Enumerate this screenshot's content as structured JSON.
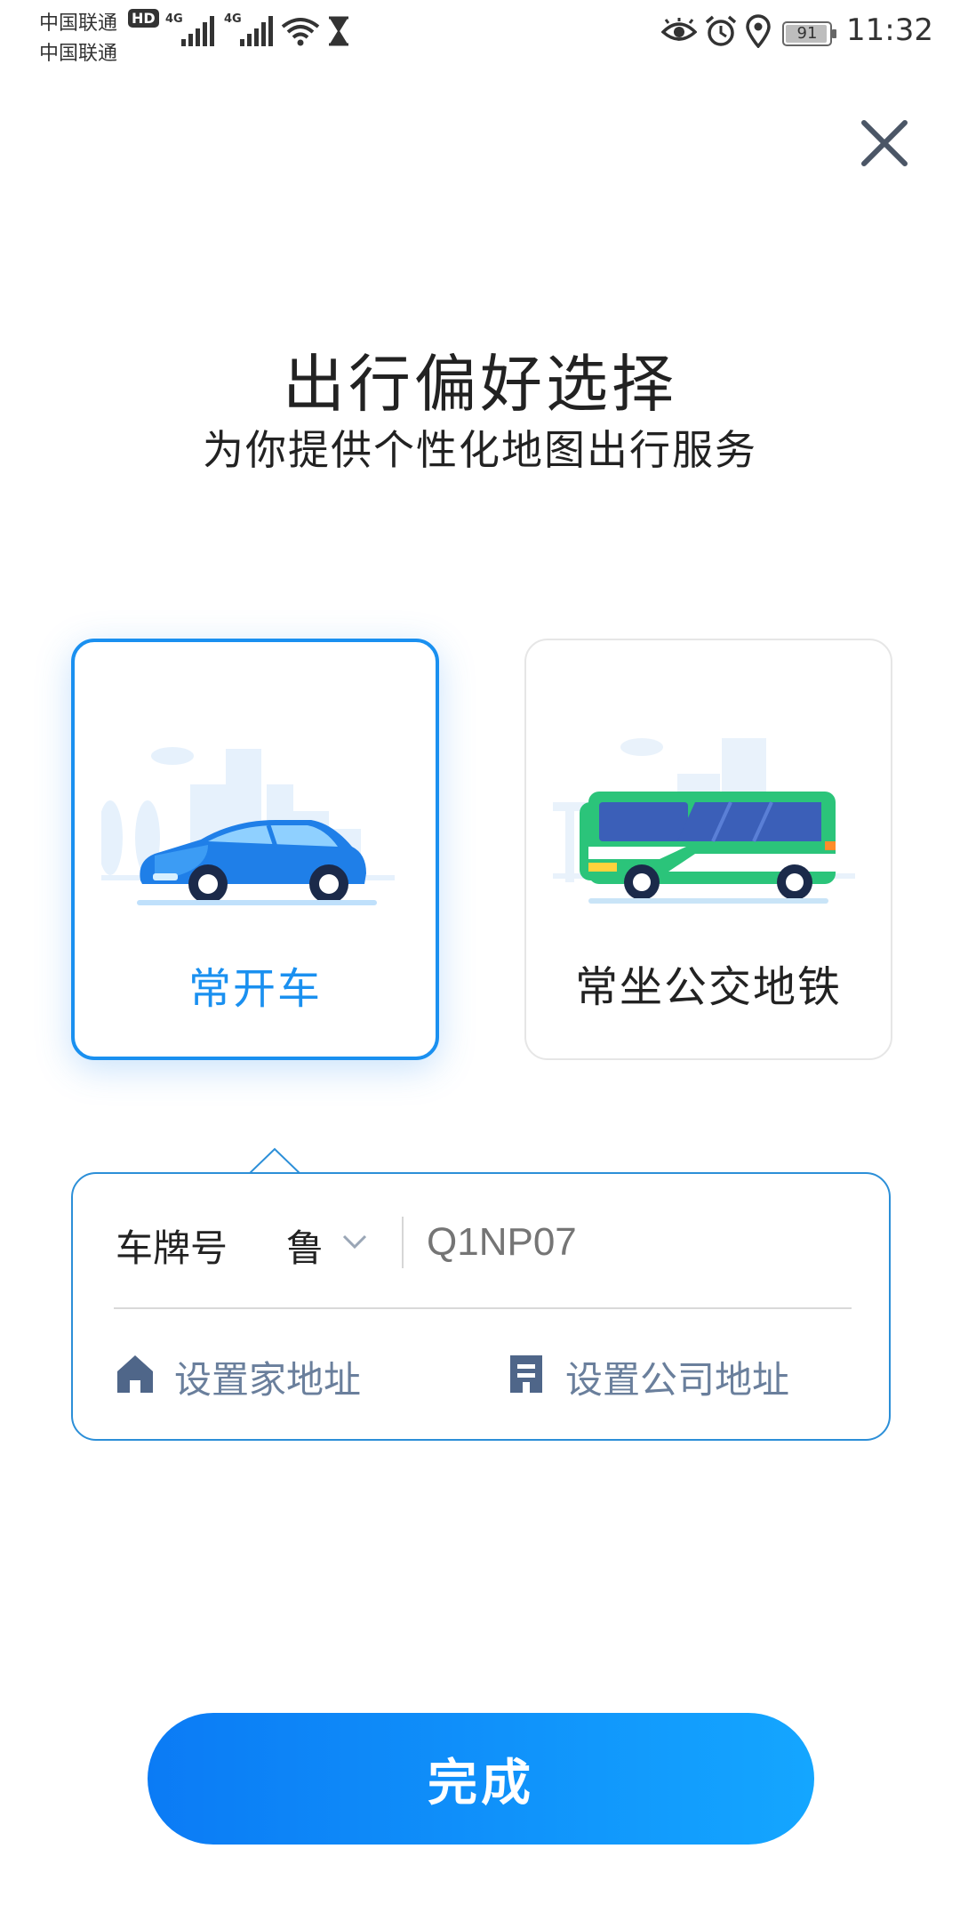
{
  "status_bar": {
    "carrier_1": "中国联通",
    "carrier_2": "中国联通",
    "hd_badge": "HD",
    "network_1": "4G",
    "network_2": "4G",
    "battery": "91",
    "time": "11:32",
    "icons": [
      "hd-badge",
      "signal-icon",
      "wifi-icon",
      "hourglass-icon",
      "eye-icon",
      "alarm-icon",
      "location-icon",
      "battery-icon"
    ]
  },
  "header": {
    "close_icon": "close-icon",
    "title": "出行偏好选择",
    "subtitle": "为你提供个性化地图出行服务"
  },
  "options": [
    {
      "label": "常开车",
      "selected": true,
      "icon": "car-illustration"
    },
    {
      "label": "常坐公交地铁",
      "selected": false,
      "icon": "bus-illustration"
    }
  ],
  "form": {
    "plate_label": "车牌号",
    "province": "鲁",
    "plate_placeholder": "Q1NP07",
    "home_label": "设置家地址",
    "home_icon": "home-icon",
    "work_label": "设置公司地址",
    "work_icon": "company-icon"
  },
  "done_button": "完成",
  "colors": {
    "accent": "#1a90f0",
    "button_start": "#0b7bf5",
    "button_end": "#14a6ff",
    "panel_border": "#2c8fd8",
    "secondary_text": "#6a7f9c"
  }
}
